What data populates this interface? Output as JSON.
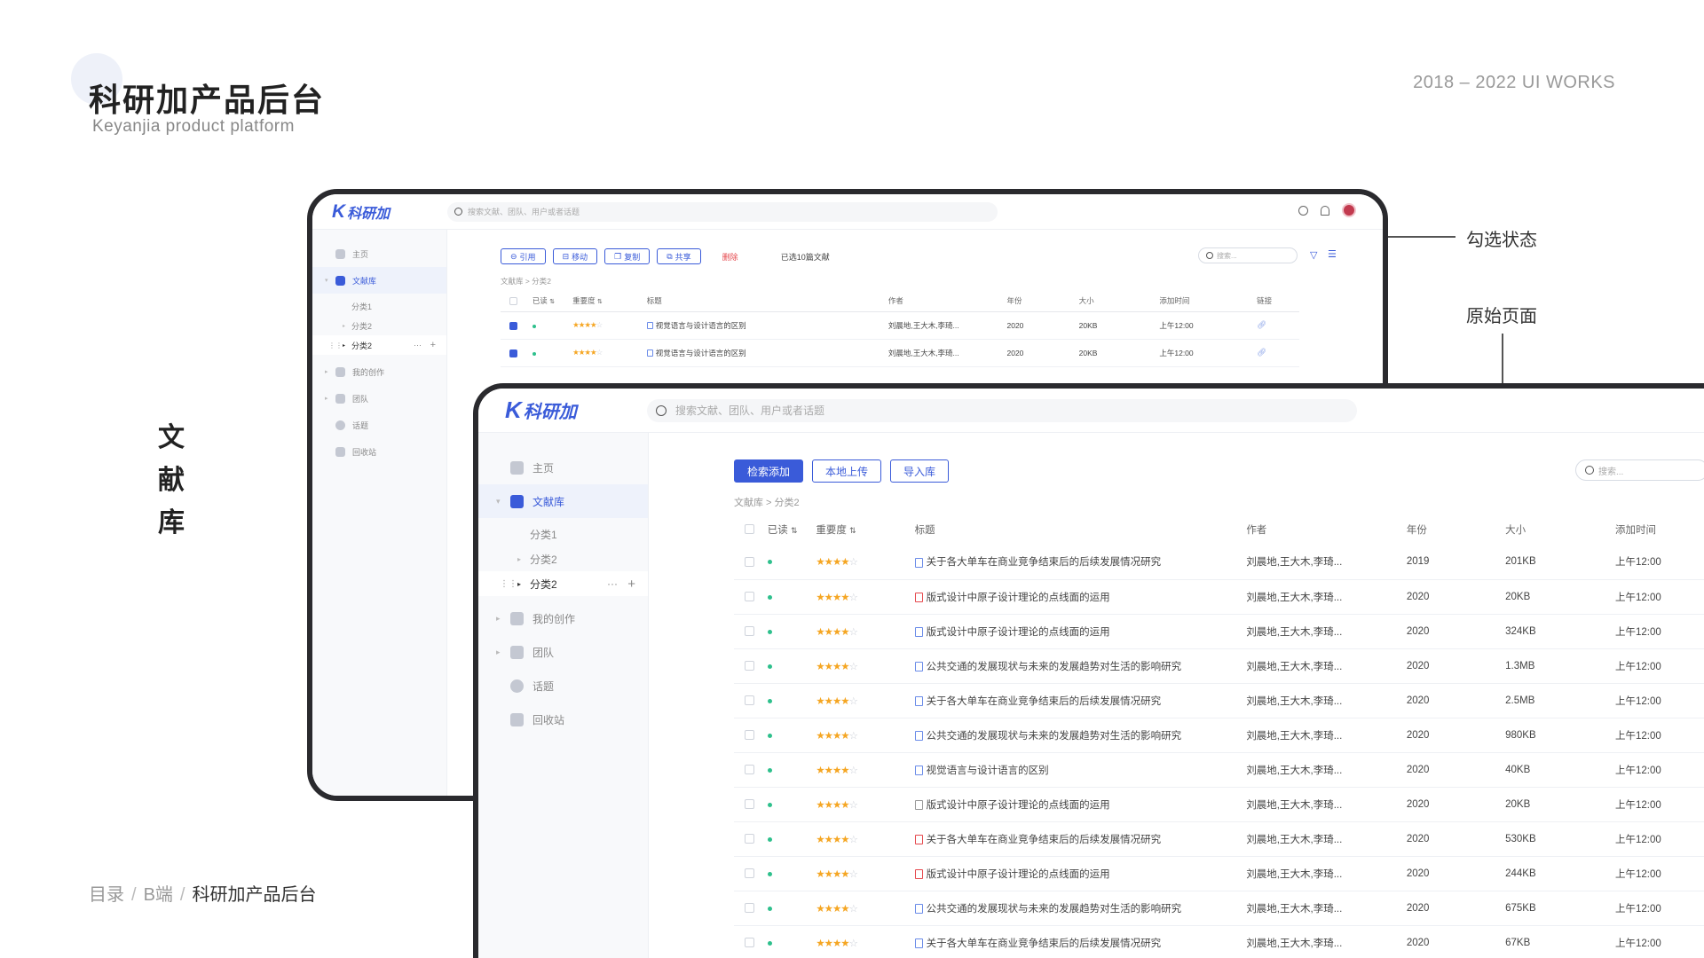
{
  "header": {
    "title": "科研加产品后台",
    "subtitle": "Keyanjia product platform",
    "works": "2018 – 2022 UI WORKS",
    "section_label": "文献库"
  },
  "annotations": {
    "checked_state": "勾选状态",
    "original_page": "原始页面"
  },
  "footer": {
    "crumb1": "目录",
    "crumb2": "B端",
    "crumb3": "科研加产品后台",
    "separator": "/"
  },
  "app": {
    "logo": "科研加",
    "logo_k": "K",
    "search_placeholder": "搜索文献、团队、用户或者话题",
    "nav": [
      {
        "label": "主页",
        "icon": "home-icon"
      },
      {
        "label": "文献库",
        "icon": "library-icon"
      },
      {
        "label": "我的创作",
        "icon": "creation-icon"
      },
      {
        "label": "团队",
        "icon": "team-icon"
      },
      {
        "label": "话题",
        "icon": "topic-icon"
      },
      {
        "label": "回收站",
        "icon": "trash-icon"
      }
    ],
    "sub_nav": [
      "分类1",
      "分类2",
      "分类2"
    ],
    "small_search": "搜索..."
  },
  "back_page": {
    "toolbar": {
      "cite": "引用",
      "move": "移动",
      "copy": "复制",
      "share": "共享",
      "delete": "删除",
      "selected": "已选10篇文献"
    },
    "breadcrumb": "文献库 > 分类2",
    "columns": [
      "已读",
      "重要度",
      "标题",
      "作者",
      "年份",
      "大小",
      "添加时间",
      "链接"
    ],
    "rows": [
      {
        "title": "视觉语言与设计语言的区别",
        "author": "刘晨地,王大木,李琦...",
        "year": "2020",
        "size": "20KB",
        "time": "上午12:00"
      },
      {
        "title": "视觉语言与设计语言的区别",
        "author": "刘晨地,王大木,李琦...",
        "year": "2020",
        "size": "20KB",
        "time": "上午12:00"
      }
    ]
  },
  "front_page": {
    "toolbar": {
      "search_add": "检索添加",
      "local_upload": "本地上传",
      "import": "导入库"
    },
    "breadcrumb": "文献库 > 分类2",
    "columns": [
      "已读",
      "重要度",
      "标题",
      "作者",
      "年份",
      "大小",
      "添加时间"
    ],
    "rows": [
      {
        "title": "关于各大单车在商业竞争结束后的后续发展情况研究",
        "author": "刘晨地,王大木,李琦...",
        "year": "2019",
        "size": "201KB",
        "time": "上午12:00",
        "file": "blue"
      },
      {
        "title": "版式设计中原子设计理论的点线面的运用",
        "author": "刘晨地,王大木,李琦...",
        "year": "2020",
        "size": "20KB",
        "time": "上午12:00",
        "file": "red"
      },
      {
        "title": "版式设计中原子设计理论的点线面的运用",
        "author": "刘晨地,王大木,李琦...",
        "year": "2020",
        "size": "324KB",
        "time": "上午12:00",
        "file": "blue"
      },
      {
        "title": "公共交通的发展现状与未来的发展趋势对生活的影响研究",
        "author": "刘晨地,王大木,李琦...",
        "year": "2020",
        "size": "1.3MB",
        "time": "上午12:00",
        "file": "blue"
      },
      {
        "title": "关于各大单车在商业竞争结束后的后续发展情况研究",
        "author": "刘晨地,王大木,李琦...",
        "year": "2020",
        "size": "2.5MB",
        "time": "上午12:00",
        "file": "blue"
      },
      {
        "title": "公共交通的发展现状与未来的发展趋势对生活的影响研究",
        "author": "刘晨地,王大木,李琦...",
        "year": "2020",
        "size": "980KB",
        "time": "上午12:00",
        "file": "blue"
      },
      {
        "title": "视觉语言与设计语言的区别",
        "author": "刘晨地,王大木,李琦...",
        "year": "2020",
        "size": "40KB",
        "time": "上午12:00",
        "file": "blue"
      },
      {
        "title": "版式设计中原子设计理论的点线面的运用",
        "author": "刘晨地,王大木,李琦...",
        "year": "2020",
        "size": "20KB",
        "time": "上午12:00",
        "file": "gray"
      },
      {
        "title": "关于各大单车在商业竞争结束后的后续发展情况研究",
        "author": "刘晨地,王大木,李琦...",
        "year": "2020",
        "size": "530KB",
        "time": "上午12:00",
        "file": "red"
      },
      {
        "title": "版式设计中原子设计理论的点线面的运用",
        "author": "刘晨地,王大木,李琦...",
        "year": "2020",
        "size": "244KB",
        "time": "上午12:00",
        "file": "red"
      },
      {
        "title": "公共交通的发展现状与未来的发展趋势对生活的影响研究",
        "author": "刘晨地,王大木,李琦...",
        "year": "2020",
        "size": "675KB",
        "time": "上午12:00",
        "file": "blue"
      },
      {
        "title": "关于各大单车在商业竞争结束后的后续发展情况研究",
        "author": "刘晨地,王大木,李琦...",
        "year": "2020",
        "size": "67KB",
        "time": "上午12:00",
        "file": "blue"
      }
    ]
  },
  "rating": {
    "filled": 4,
    "max": 5
  },
  "colors": {
    "accent": "#3a5bd9",
    "read_dot": "#2ec08c",
    "star": "#f5a623",
    "danger": "#e5484d"
  }
}
